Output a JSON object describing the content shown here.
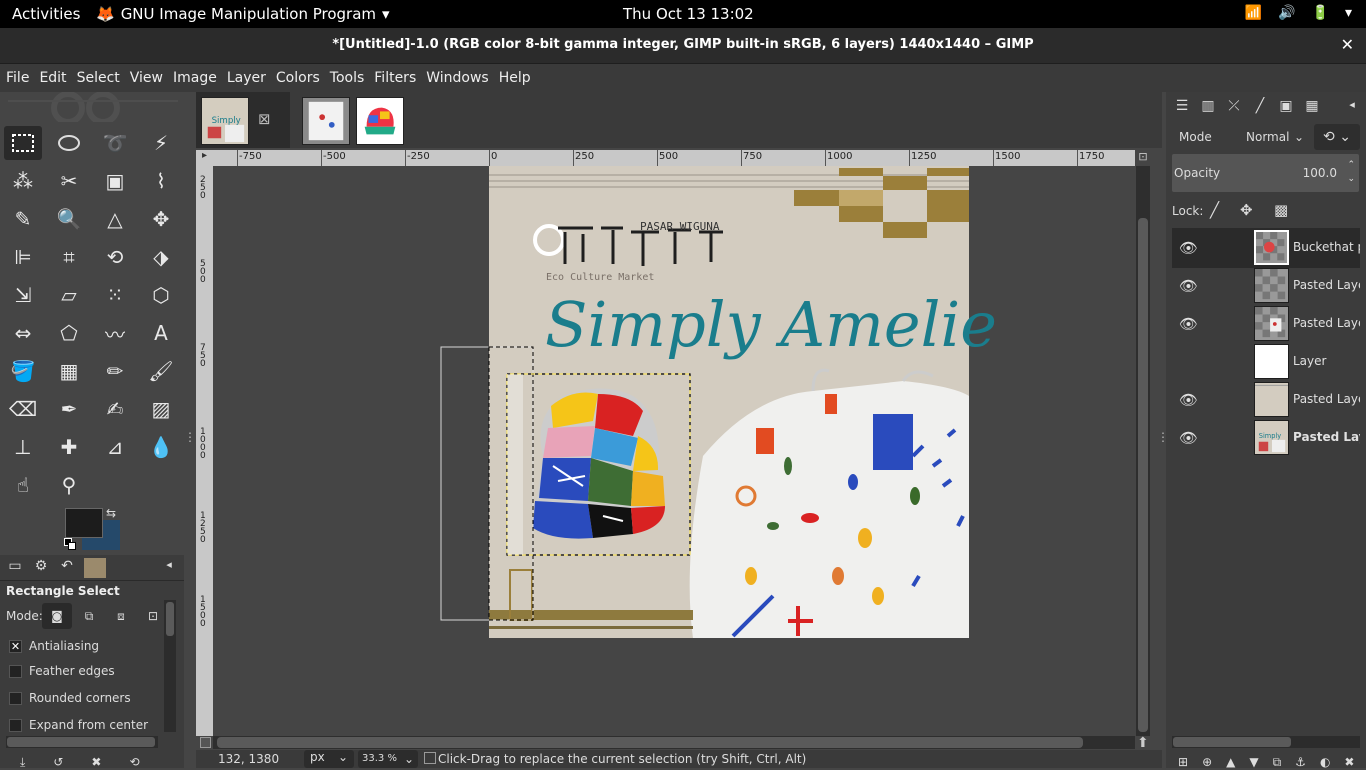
{
  "topbar": {
    "activities": "Activities",
    "app_name": "GNU Image Manipulation Program",
    "clock": "Thu Oct 13  13:02"
  },
  "window": {
    "title": "*[Untitled]-1.0 (RGB color 8-bit gamma integer, GIMP built-in sRGB, 6 layers) 1440x1440 – GIMP"
  },
  "menu": [
    "File",
    "Edit",
    "Select",
    "View",
    "Image",
    "Layer",
    "Colors",
    "Tools",
    "Filters",
    "Windows",
    "Help"
  ],
  "tool_options": {
    "title": "Rectangle Select",
    "mode_label": "Mode:",
    "antialiasing": "Antialiasing",
    "feather": "Feather edges",
    "rounded": "Rounded corners",
    "expand": "Expand from center"
  },
  "ruler_h": [
    "-750",
    "-500",
    "-250",
    "0",
    "250",
    "500",
    "750",
    "1000",
    "1250",
    "1500",
    "1750"
  ],
  "ruler_v": [
    "250",
    "500",
    "750",
    "1000",
    "1250",
    "1500"
  ],
  "status": {
    "coords": "132, 1380",
    "unit": "px",
    "zoom": "33.3 %",
    "message": "Click-Drag to replace the current selection (try Shift, Ctrl, Alt)"
  },
  "layers_panel": {
    "mode_label": "Mode",
    "mode_value": "Normal",
    "opacity_label": "Opacity",
    "opacity_value": "100.0",
    "lock_label": "Lock:",
    "layers": [
      {
        "name": "Buckethat pa",
        "visible": true
      },
      {
        "name": "Pasted Layer",
        "visible": true
      },
      {
        "name": "Pasted Layer",
        "visible": true
      },
      {
        "name": "Layer",
        "visible": false
      },
      {
        "name": "Pasted Layer",
        "visible": true
      },
      {
        "name": "Pasted Laye",
        "visible": true
      }
    ]
  },
  "poster": {
    "brand_small": "PASAR WIGUNA",
    "tagline": "Eco Culture Market",
    "headline": "Simply Amelie"
  },
  "colors": {
    "accent_teal": "#1a7d8c",
    "gold": "#9b7f3a",
    "fg_color": "#1c1c1c",
    "bg_color": "#25496a"
  }
}
